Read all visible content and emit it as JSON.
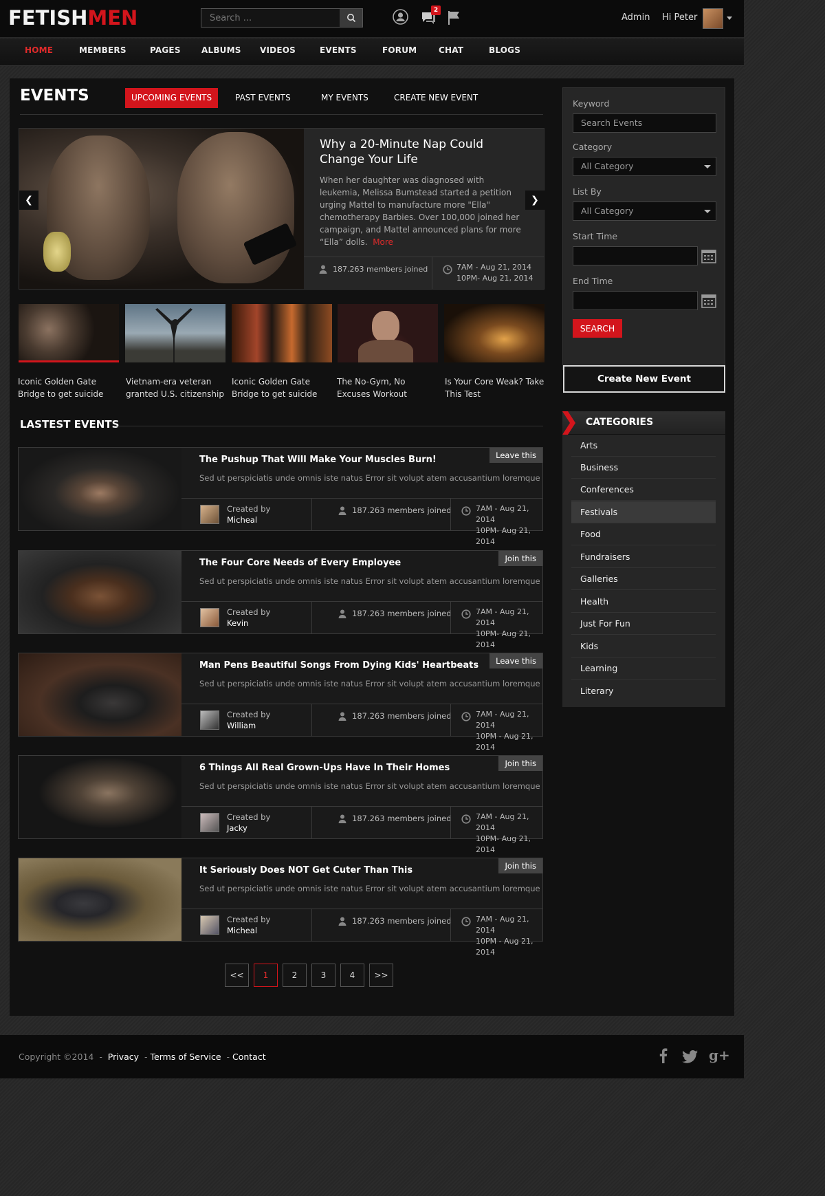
{
  "header": {
    "logo_part1": "FETISH",
    "logo_part2": "MEN",
    "search_placeholder": "Search ...",
    "notification_count": "2",
    "admin_label": "Admin",
    "greeting": "Hi Peter"
  },
  "nav": {
    "items": [
      "HOME",
      "MEMBERS",
      "PAGES",
      "ALBUMS",
      "VIDEOS",
      "EVENTS",
      "FORUM",
      "CHAT",
      "BLOGS"
    ],
    "active": "HOME"
  },
  "page": {
    "title": "EVENTS",
    "tabs": [
      "UPCOMING EVENTS",
      "PAST EVENTS",
      "MY EVENTS",
      "CREATE NEW EVENT"
    ]
  },
  "featured": {
    "title": "Why a 20-Minute Nap Could Change Your Life",
    "description": "When her daughter was diagnosed with leukemia, Melissa Bumstead started a petition urging Mattel to manufacture more \"Ella\" chemotherapy Barbies. Over 100,000 joined her campaign, and Mattel announced plans for more “Ella” dolls.",
    "more_label": "More",
    "members": "187.263 members joined",
    "time_line1": "7AM - Aug 21, 2014",
    "time_line2": "10PM- Aug 21, 2014"
  },
  "thumbnails": [
    {
      "caption": "Iconic Golden Gate Bridge to get suicide"
    },
    {
      "caption": "Vietnam-era veteran granted U.S. citizenship"
    },
    {
      "caption": "Iconic Golden Gate Bridge to get suicide"
    },
    {
      "caption": "The No-Gym, No Excuses Workout"
    },
    {
      "caption": "Is Your Core Weak? Take This Test"
    }
  ],
  "latest": {
    "heading": "LASTEST EVENTS",
    "events": [
      {
        "title": "The Pushup That Will Make Your Muscles Burn!",
        "description": "Sed ut perspiciatis unde omnis iste natus Error sit volupt atem accusantium loremque",
        "action": "Leave this",
        "created_label": "Created by",
        "creator": "Micheal",
        "members": "187.263 members joined",
        "time_line1": "7AM - Aug 21, 2014",
        "time_line2": "10PM- Aug 21, 2014"
      },
      {
        "title": "The Four Core Needs of Every Employee",
        "description": "Sed ut perspiciatis unde omnis iste natus Error sit volupt atem accusantium loremque",
        "action": "Join this",
        "created_label": "Created by",
        "creator": "Kevin",
        "members": "187.263 members joined",
        "time_line1": "7AM - Aug 21, 2014",
        "time_line2": "10PM- Aug 21, 2014"
      },
      {
        "title": "Man Pens Beautiful Songs From Dying Kids' Heartbeats",
        "description": "Sed ut perspiciatis unde omnis iste natus Error sit volupt atem accusantium loremque",
        "action": "Leave this",
        "created_label": "Created by",
        "creator": "William",
        "members": "187.263 members joined",
        "time_line1": "7AM - Aug 21, 2014",
        "time_line2": "10PM - Aug 21, 2014"
      },
      {
        "title": "6 Things All Real Grown-Ups Have In Their Homes",
        "description": "Sed ut perspiciatis unde omnis iste natus Error sit volupt atem accusantium loremque",
        "action": "Join this",
        "created_label": "Created by",
        "creator": "Jacky",
        "members": "187.263 members joined",
        "time_line1": "7AM - Aug 21, 2014",
        "time_line2": "10PM- Aug 21, 2014"
      },
      {
        "title": "It Seriously Does NOT Get Cuter Than This",
        "description": "Sed ut perspiciatis unde omnis iste natus Error sit volupt atem accusantium loremque",
        "action": "Join this",
        "created_label": "Created by",
        "creator": "Micheal",
        "members": "187.263 members joined",
        "time_line1": "7AM - Aug 21, 2014",
        "time_line2": "10PM - Aug 21, 2014"
      }
    ]
  },
  "pagination": {
    "prev": "<<",
    "pages": [
      "1",
      "2",
      "3",
      "4"
    ],
    "next": ">>",
    "current": "1"
  },
  "sidebar": {
    "keyword_label": "Keyword",
    "keyword_placeholder": "Search Events",
    "category_label": "Category",
    "category_value": "All Category",
    "listby_label": "List By",
    "listby_value": "All Category",
    "start_label": "Start Time",
    "end_label": "End Time",
    "search_button": "SEARCH",
    "create_button": "Create New Event"
  },
  "categories": {
    "heading": "CATEGORIES",
    "items": [
      "Arts",
      "Business",
      "Conferences",
      "Festivals",
      "Food",
      "Fundraisers",
      "Galleries",
      "Health",
      "Just For Fun",
      "Kids",
      "Learning",
      "Literary"
    ],
    "highlighted": "Festivals"
  },
  "footer": {
    "copyright": "Copyright ©2014",
    "links": [
      "Privacy",
      "Terms of Service",
      "Contact"
    ]
  },
  "colors": {
    "accent": "#d3151c",
    "background": "#111111",
    "panel": "#262626"
  }
}
